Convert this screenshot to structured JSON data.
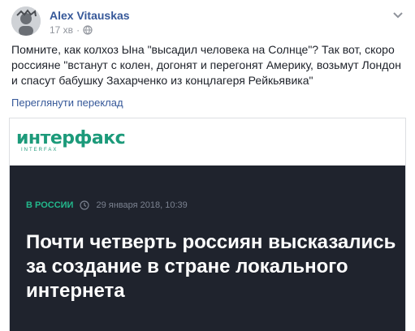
{
  "post": {
    "author": "Alex Vitauskas",
    "time": "17 хв",
    "text": "Помните, как колхоз Ына \"высадил человека на Солнце\"? Так вот, скоро россияне \"встанут с колен, догонят и перегонят Америку, возьмут Лондон и спасут бабушку Захарченко из концлагеря Рейкьявика\"",
    "translate_link": "Переглянути переклад",
    "icons": {
      "avatar": "avatar-icon",
      "privacy": "globe-icon",
      "menu": "chevron-down-icon"
    }
  },
  "card": {
    "logo_text": "интерфакс",
    "logo_subtext": "INTERFAX",
    "rubric": "В РОССИИ",
    "date": "29 января 2018, 10:39",
    "headline": "Почти четверть россиян высказались за создание в стране локального интернета",
    "colors": {
      "brand": "#1c9a7a",
      "background": "#1f232d",
      "rubric": "#23b88c"
    }
  }
}
